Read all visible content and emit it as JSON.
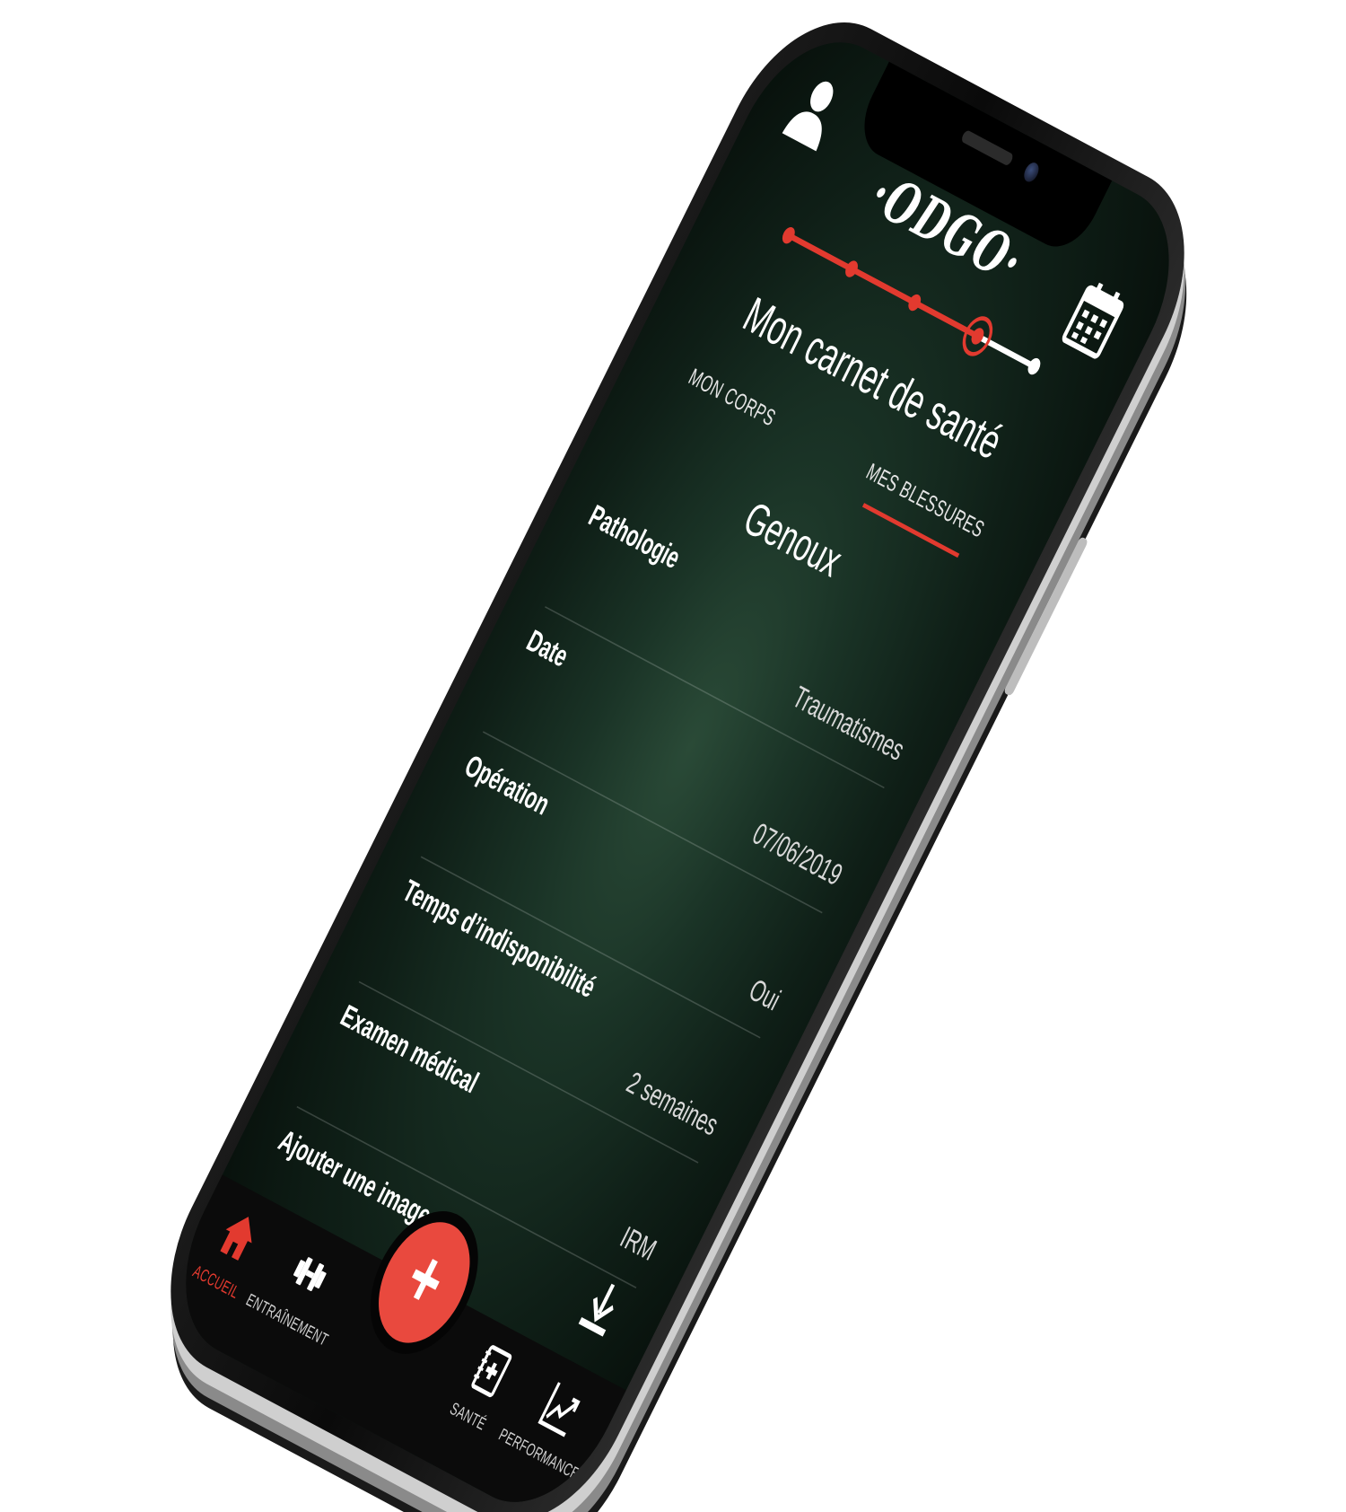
{
  "app": {
    "logo_text": "·ODGO·",
    "accent_color": "#e23a2f",
    "background_color": "#1a3326"
  },
  "header": {
    "profile_icon": "user-icon",
    "calendar_icon": "calendar-icon",
    "progress": {
      "total_steps": 5,
      "current_step": 4
    }
  },
  "page": {
    "title": "Mon carnet de santé"
  },
  "tabs": [
    {
      "label": "MON CORPS",
      "active": false
    },
    {
      "label": "MES BLESSURES",
      "active": true
    }
  ],
  "section": {
    "title": "Genoux"
  },
  "fields": [
    {
      "label": "Pathologie",
      "value": "Traumatismes"
    },
    {
      "label": "Date",
      "value": "07/06/2019"
    },
    {
      "label": "Opération",
      "value": "Oui"
    },
    {
      "label": "Temps d’indisponibilité",
      "value": "2 semaines"
    },
    {
      "label": "Examen médical",
      "value": "IRM"
    },
    {
      "label": "Ajouter une image",
      "value": ""
    }
  ],
  "upload_icon": "download-icon",
  "nav": {
    "items": [
      {
        "label": "ACCUEIL",
        "icon": "home-icon",
        "active": true
      },
      {
        "label": "ENTRAÎNEMENT",
        "icon": "dumbbell-icon",
        "active": false
      },
      {
        "label": "SANTÉ",
        "icon": "health-book-icon",
        "active": false
      },
      {
        "label": "PERFORMANCE",
        "icon": "chart-icon",
        "active": false
      }
    ],
    "fab_label": "+"
  }
}
